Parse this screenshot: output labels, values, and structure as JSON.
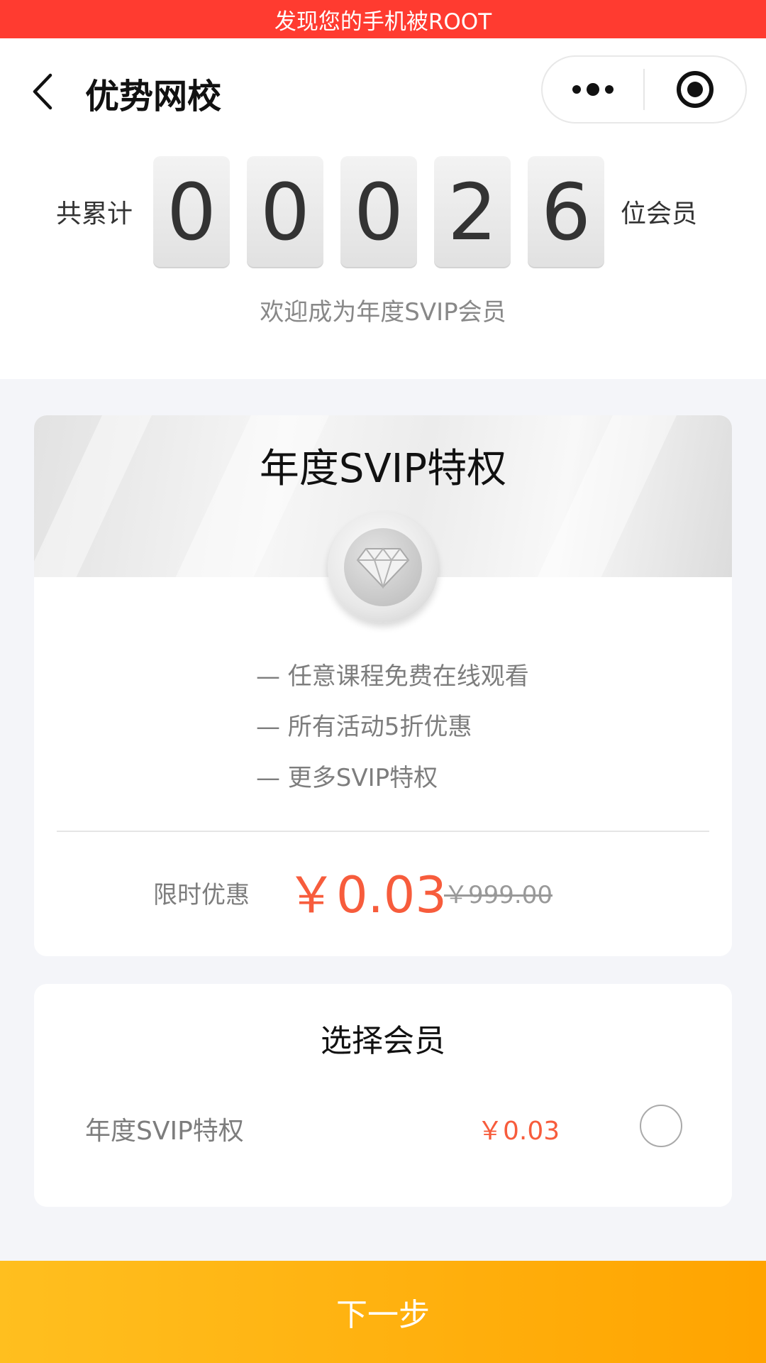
{
  "banner": {
    "text": "发现您的手机被ROOT",
    "color": "#ff3b30"
  },
  "nav": {
    "title": "优势网校",
    "back_icon": "chevron-left-icon",
    "menu_icon": "more-dots-icon",
    "close_icon": "target-circle-icon"
  },
  "counter": {
    "prefix": "共累计",
    "digits": [
      "0",
      "0",
      "0",
      "2",
      "6"
    ],
    "suffix": "位会员",
    "welcome": "欢迎成为年度SVIP会员"
  },
  "privilege": {
    "title": "年度SVIP特权",
    "badge_icon": "diamond-medal-icon",
    "benefits": [
      "— 任意课程免费在线观看",
      "— 所有活动5折优惠",
      "— 更多SVIP特权"
    ],
    "price_label": "限时优惠",
    "price_now": "￥0.03",
    "price_original": "￥999.00"
  },
  "select": {
    "title": "选择会员",
    "options": [
      {
        "name": "年度SVIP特权",
        "price": "￥0.03",
        "selected": false
      }
    ]
  },
  "footer": {
    "next_label": "下一步"
  },
  "colors": {
    "accent_price": "#f75c3c",
    "button_start": "#ffbf1f",
    "button_end": "#ffa400"
  }
}
